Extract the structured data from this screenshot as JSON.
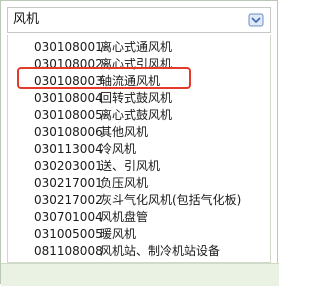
{
  "search": {
    "value": "风机"
  },
  "items": [
    {
      "code": "030108001",
      "name": "离心式通风机"
    },
    {
      "code": "030108002",
      "name": "离心式引风机"
    },
    {
      "code": "030108003",
      "name": "轴流通风机"
    },
    {
      "code": "030108004",
      "name": "回转式鼓风机"
    },
    {
      "code": "030108005",
      "name": "离心式鼓风机"
    },
    {
      "code": "030108006",
      "name": "其他风机"
    },
    {
      "code": "030113004",
      "name": "冷风机"
    },
    {
      "code": "030203001",
      "name": "送、引风机"
    },
    {
      "code": "030217001",
      "name": "负压风机"
    },
    {
      "code": "030217002",
      "name": "灰斗气化风机(包括气化板)"
    },
    {
      "code": "030701004",
      "name": "风机盘管"
    },
    {
      "code": "031005005",
      "name": "暖风机"
    },
    {
      "code": "081108008",
      "name": "风机站、制冷机站设备"
    }
  ],
  "highlighted_item": "030108003",
  "colors": {
    "highlight_border": "#e23b2a",
    "footer_bg": "#eaf3e3"
  },
  "icons": {
    "search_button": "dropdown-arrow-icon"
  }
}
